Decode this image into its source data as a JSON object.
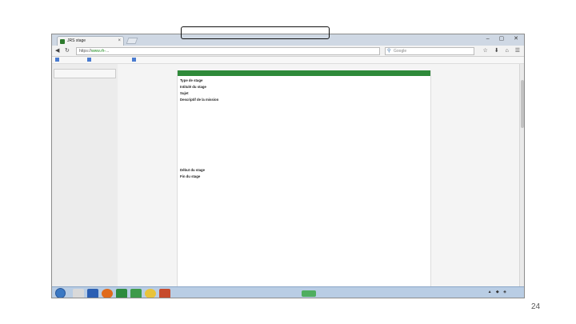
{
  "browser": {
    "tab_title": "JRS stage",
    "url_prefix": "https://",
    "url_host": "www.rh-",
    "url_rest": "...",
    "search_placeholder": "Google",
    "bookmarks": [
      "",
      "",
      ""
    ]
  },
  "leftnav": {
    "crumb": "",
    "item": ""
  },
  "content": {
    "header": "",
    "section_title": "",
    "rows": [
      {
        "label": "Type de stage",
        "value": ""
      },
      {
        "label": "Intitulé du stage",
        "value": ""
      },
      {
        "label": "Sujet",
        "value": ""
      },
      {
        "label": "Descriptif de la mission",
        "value": ""
      },
      {
        "label": "",
        "value": ""
      },
      {
        "label": "",
        "value": ""
      },
      {
        "label": "",
        "value": ""
      },
      {
        "label": "",
        "value": ""
      },
      {
        "label": "",
        "value": ""
      },
      {
        "label": "Début du stage",
        "value": ""
      },
      {
        "label": "Fin du stage",
        "value": ""
      },
      {
        "label": "",
        "value": ""
      },
      {
        "label": "",
        "value": ""
      },
      {
        "label": "",
        "value": ""
      },
      {
        "label": "",
        "value": ""
      },
      {
        "label": "",
        "value": ""
      },
      {
        "label": "",
        "value": ""
      },
      {
        "label": "",
        "value": ""
      },
      {
        "label": "",
        "value": ""
      },
      {
        "label": "",
        "value": ""
      },
      {
        "label": "",
        "value": ""
      },
      {
        "label": "",
        "value": ""
      },
      {
        "label": "",
        "value": ""
      },
      {
        "label": "",
        "value": ""
      },
      {
        "label": "",
        "value": ""
      },
      {
        "label": "",
        "value": ""
      },
      {
        "label": "",
        "value": ""
      },
      {
        "label": "",
        "value": ""
      },
      {
        "label": "",
        "value": ""
      },
      {
        "label": "",
        "value": ""
      }
    ]
  },
  "taskbar": {
    "clock_time": "",
    "clock_date": ""
  },
  "slide_number": "24",
  "colors": {
    "header_green": "#2f8a3a",
    "taskbar": "#b9cde4"
  }
}
